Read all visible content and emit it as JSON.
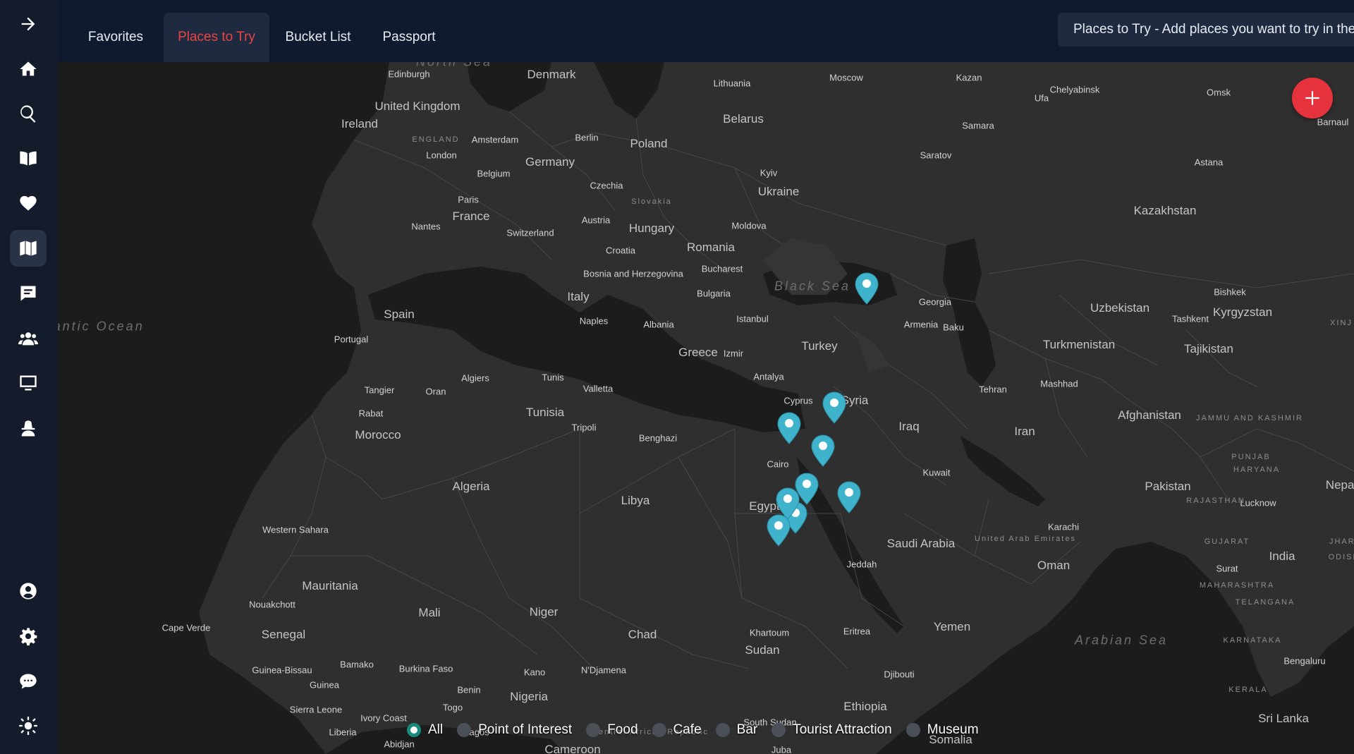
{
  "tabs": [
    {
      "label": "Favorites",
      "active": false
    },
    {
      "label": "Places to Try",
      "active": true
    },
    {
      "label": "Bucket List",
      "active": false
    },
    {
      "label": "Passport",
      "active": false
    }
  ],
  "info_text": "Places to Try - Add places you want to try in the future.",
  "sidebar": {
    "items": [
      {
        "icon": "arrow-right-icon"
      },
      {
        "icon": "home-icon"
      },
      {
        "icon": "search-icon"
      },
      {
        "icon": "book-open-icon"
      },
      {
        "icon": "heart-icon"
      },
      {
        "icon": "map-icon",
        "active": true
      },
      {
        "icon": "comment-icon"
      },
      {
        "icon": "users-icon"
      },
      {
        "icon": "monitor-icon"
      },
      {
        "icon": "user-secret-icon"
      },
      {
        "icon": "user-circle-icon"
      },
      {
        "icon": "gear-icon"
      },
      {
        "icon": "chat-bubble-icon"
      },
      {
        "icon": "sun-icon"
      }
    ]
  },
  "colors": {
    "accent_red": "#e84545",
    "add_button": "#e5323c",
    "pin": "#3fb3cc",
    "radio_checked": "#1a8a7a"
  },
  "filters": [
    {
      "label": "All",
      "checked": true
    },
    {
      "label": "Point of Interest",
      "checked": false
    },
    {
      "label": "Food",
      "checked": false
    },
    {
      "label": "Cafe",
      "checked": false
    },
    {
      "label": "Bar",
      "checked": false
    },
    {
      "label": "Tourist Attraction",
      "checked": false
    },
    {
      "label": "Museum",
      "checked": false
    }
  ],
  "map_labels": {
    "countries": [
      "Denmark",
      "United Kingdom",
      "Ireland",
      "Germany",
      "Poland",
      "Belarus",
      "France",
      "Czechia",
      "Ukraine",
      "Hungary",
      "Romania",
      "Kazakhstan",
      "Italy",
      "Spain",
      "Portugal",
      "Bulgaria",
      "Turkey",
      "Greece",
      "Uzbekistan",
      "Kyrgyzstan",
      "Turkmenistan",
      "Tajikistan",
      "Syria",
      "Iraq",
      "Iran",
      "Afghanistan",
      "Tunisia",
      "Morocco",
      "Algeria",
      "Libya",
      "Egypt",
      "Pakistan",
      "Saudi Arabia",
      "Western Sahara",
      "Mauritania",
      "Mali",
      "Niger",
      "Chad",
      "Sudan",
      "Oman",
      "Yemen",
      "Senegal",
      "Nigeria",
      "Ethiopia",
      "India",
      "Nepal",
      "Sri Lanka",
      "Somalia",
      "Eritrea",
      "Djibouti",
      "Guinea",
      "Togo",
      "Benin",
      "Liberia",
      "Croatia",
      "Slovakia",
      "Austria",
      "Switzerland",
      "Belgium",
      "Moldova",
      "Georgia",
      "Armenia",
      "Lithuania",
      "Bosnia and Herzegovina",
      "Albania",
      "Cyprus",
      "Kuwait",
      "United Arab Emirates",
      "Guinea-Bissau",
      "Sierra Leone",
      "Ivory Coast",
      "Burkina Faso",
      "Cameroon",
      "Central African Republic",
      "South Sudan"
    ],
    "cities": [
      "Edinburgh",
      "Moscow",
      "Kazan",
      "Chelyabinsk",
      "Omsk",
      "Ufa",
      "Samara",
      "Saratov",
      "Astana",
      "Amsterdam",
      "London",
      "Berlin",
      "Paris",
      "Nantes",
      "Kyiv",
      "Bucharest",
      "Istanbul",
      "Naples",
      "Izmir",
      "Antalya",
      "Baku",
      "Tashkent",
      "Bishkek",
      "Tehran",
      "Mashhad",
      "Algiers",
      "Tunis",
      "Valletta",
      "Oran",
      "Tangier",
      "Rabat",
      "Tripoli",
      "Benghazi",
      "Cairo",
      "Karachi",
      "Lucknow",
      "Jeddah",
      "Surat",
      "Khartoum",
      "Nouakchott",
      "Bamako",
      "Kano",
      "N'Djamena",
      "Bengaluru",
      "Abidjan",
      "Juba",
      "Lagos",
      "Barnaul",
      "Cape Verde"
    ],
    "seas": [
      "North Sea",
      "Black Sea",
      "Arabian Sea",
      "North Atlantic Ocean"
    ],
    "regions": [
      "ENGLAND",
      "XINJ",
      "JAMMU AND KASHMIR",
      "PUNJAB",
      "HARYANA",
      "RAJASTHAN",
      "GUJARAT",
      "MAHARASHTRA",
      "TELANGANA",
      "KARNATAKA",
      "KERALA",
      "JHARK",
      "ODISH"
    ]
  }
}
